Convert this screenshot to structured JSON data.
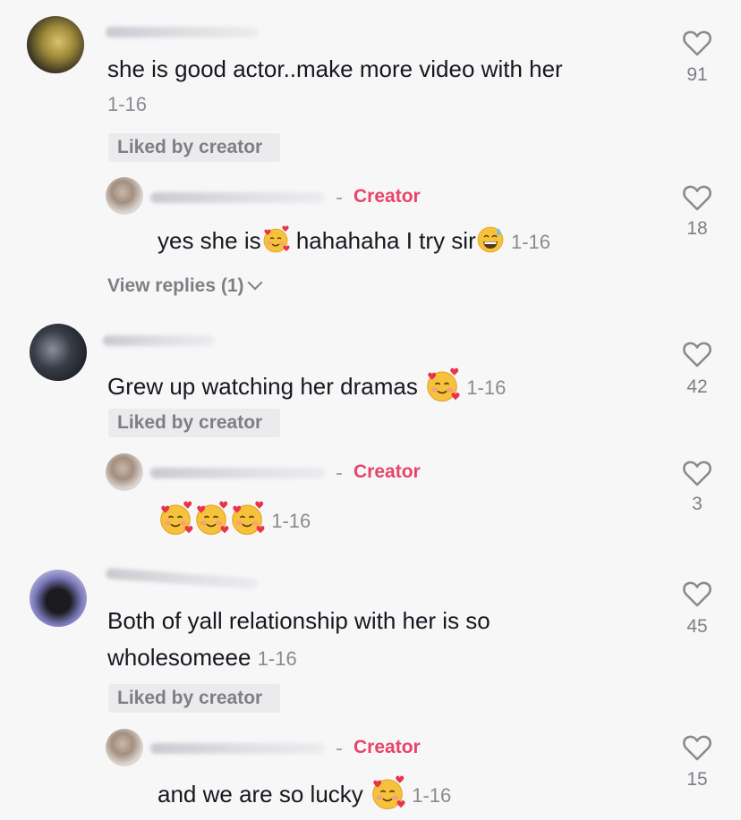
{
  "comments": [
    {
      "text": "she is good actor..make more video with her",
      "date": "1-16",
      "liked_badge": "Liked by creator",
      "likes": "91",
      "reply": {
        "tag": "Creator",
        "text_a": "yes she is",
        "text_b": " hahahaha I try sir",
        "date": "1-16",
        "likes": "18"
      },
      "view_replies": "View replies (1)"
    },
    {
      "text": "Grew up watching her dramas ",
      "date": "1-16",
      "liked_badge": "Liked by creator",
      "likes": "42",
      "reply": {
        "tag": "Creator",
        "date": "1-16",
        "likes": "3"
      }
    },
    {
      "text_line1": "Both of yall relationship with her is so",
      "text_line2": "wholesomeee",
      "date": "1-16",
      "liked_badge": "Liked by creator",
      "likes": "45",
      "reply": {
        "tag": "Creator",
        "text": "and we are so lucky ",
        "date": "1-16",
        "likes": "15"
      }
    }
  ],
  "icons": {
    "heart": "heart-outline-icon",
    "smiling_face_with_hearts": "smiling-face-with-hearts-emoji",
    "grinning_sweat": "grinning-face-with-sweat-emoji",
    "chevron": "chevron-down-icon"
  },
  "colors": {
    "background": "#f7f7f8",
    "creator_tag": "#e8446a",
    "secondary_text": "#8a8b91",
    "badge_bg": "#ebebed"
  }
}
